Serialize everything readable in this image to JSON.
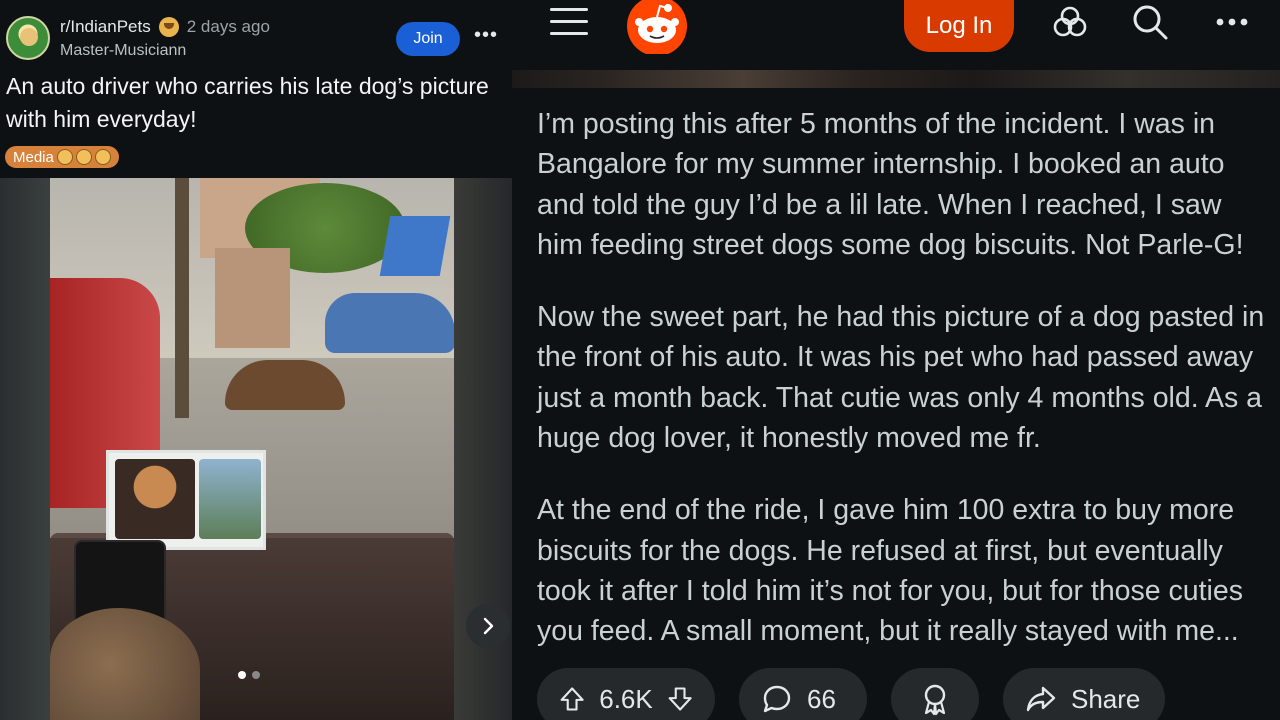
{
  "post": {
    "subreddit": "r/IndianPets",
    "time_ago": "2 days ago",
    "author": "Master-Musiciann",
    "join_label": "Join",
    "more_label": "•••",
    "title": "An auto driver who carries his late dog’s picture with him everyday!",
    "flair": "Media",
    "media": {
      "slide_count": 2,
      "active_slide": 1
    }
  },
  "nav": {
    "login_label": "Log In",
    "more_label": "•••",
    "icons": [
      "menu-icon",
      "reddit-logo",
      "communities-icon",
      "search-icon",
      "more-icon"
    ]
  },
  "body": {
    "paragraphs": [
      "I’m posting this after 5 months of the incident. I was in Bangalore for my summer internship. I booked an auto and told the guy I’d be a lil late. When I reached, I saw him feeding street dogs some dog biscuits. Not Parle-G!",
      "Now the sweet part, he had this picture of a dog pasted in the front of his auto. It was his pet who had passed away just a month back. That cutie was only 4 months old. As a huge dog lover, it honestly moved me fr.",
      "At the end of the ride, I gave him 100 extra to buy more biscuits for the dogs. He refused at first, but eventually took it after I told him it’s not for you, but for those cuties you feed. A small moment, but it really stayed with me..."
    ]
  },
  "actions": {
    "votes": "6.6K",
    "comments": "66",
    "share_label": "Share"
  },
  "colors": {
    "join_button": "#1a5fd6",
    "login_button": "#d93a00",
    "flair": "#d6823a",
    "body_text": "#c9d1d4"
  }
}
